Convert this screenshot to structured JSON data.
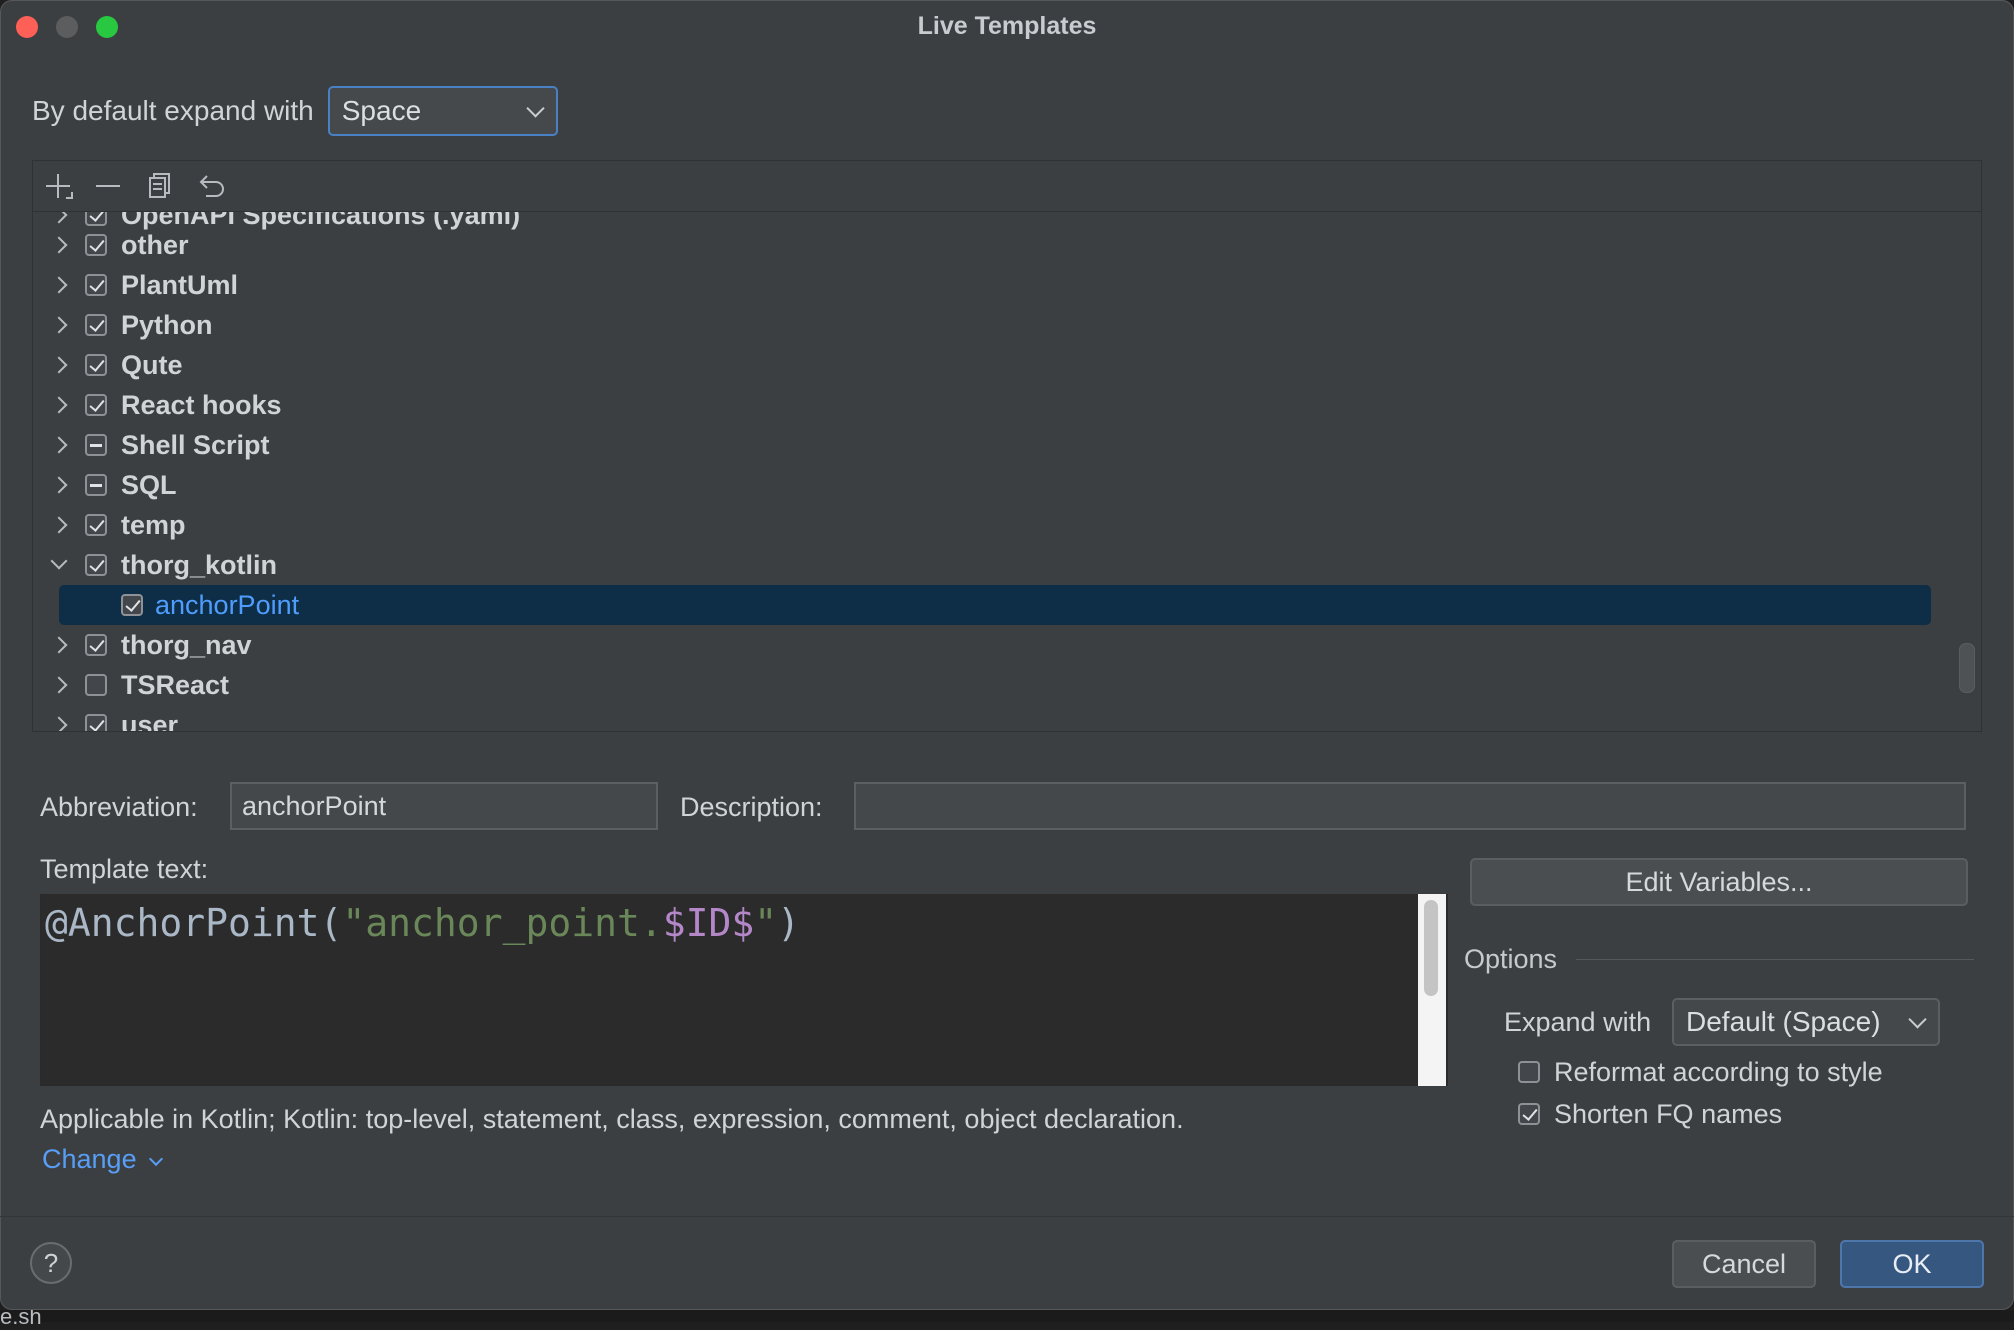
{
  "window": {
    "title": "Live Templates"
  },
  "expand_default": {
    "label": "By default expand with",
    "value": "Space"
  },
  "toolbar": {
    "add_icon": "plus-icon",
    "remove_icon": "minus-icon",
    "copy_icon": "copy-icon",
    "revert_icon": "undo-icon"
  },
  "tree": {
    "items": [
      {
        "label": "OpenAPI Specifications (.yaml)",
        "state": "checked"
      },
      {
        "label": "other",
        "state": "checked"
      },
      {
        "label": "PlantUml",
        "state": "checked"
      },
      {
        "label": "Python",
        "state": "checked"
      },
      {
        "label": "Qute",
        "state": "checked"
      },
      {
        "label": "React hooks",
        "state": "checked"
      },
      {
        "label": "Shell Script",
        "state": "partial"
      },
      {
        "label": "SQL",
        "state": "partial"
      },
      {
        "label": "temp",
        "state": "checked"
      },
      {
        "label": "thorg_kotlin",
        "state": "checked",
        "expanded": true
      },
      {
        "label": "anchorPoint",
        "state": "checked",
        "child": true,
        "selected": true
      },
      {
        "label": "thorg_nav",
        "state": "checked"
      },
      {
        "label": "TSReact",
        "state": "unchecked"
      },
      {
        "label": "user",
        "state": "checked"
      }
    ]
  },
  "abbreviation": {
    "label": "Abbreviation:",
    "value": "anchorPoint"
  },
  "description": {
    "label": "Description:",
    "value": ""
  },
  "template_text": {
    "label": "Template text:",
    "prefix": "@AnchorPoint(",
    "string_start": "\"anchor_point.",
    "variable": "$ID$",
    "string_end": "\"",
    "suffix": ")"
  },
  "edit_variables": {
    "label": "Edit Variables..."
  },
  "options": {
    "header": "Options",
    "expand_with_label": "Expand with",
    "expand_with_value": "Default (Space)",
    "reformat_label": "Reformat according to style",
    "reformat_checked": false,
    "shorten_label": "Shorten FQ names",
    "shorten_checked": true
  },
  "applicable": {
    "text": "Applicable in Kotlin; Kotlin: top-level, statement, class, expression, comment, object declaration.",
    "change_link": "Change"
  },
  "footer": {
    "help": "?",
    "cancel": "Cancel",
    "ok": "OK"
  },
  "background_text": "e.sh"
}
